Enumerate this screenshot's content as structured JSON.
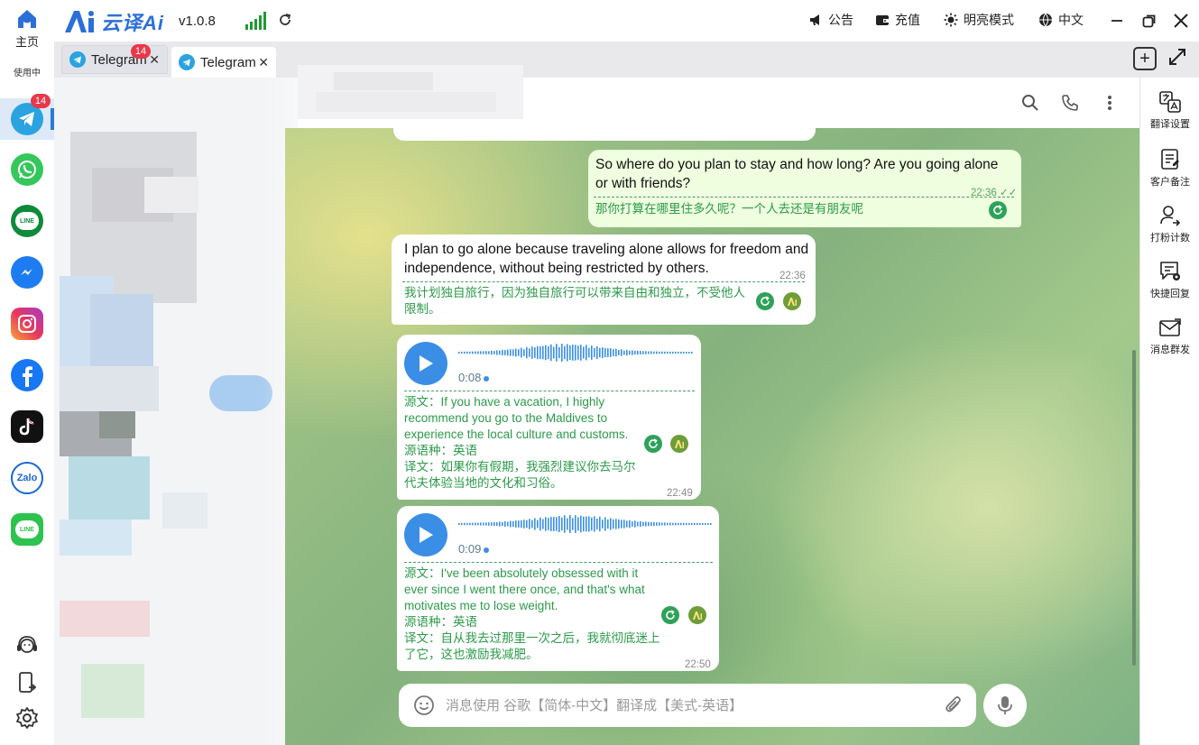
{
  "app": {
    "name": "云译Ai",
    "version": "v1.0.8",
    "home_label": "主页",
    "in_use_label": "使用中"
  },
  "titlebar": {
    "announcement": "公告",
    "recharge": "充值",
    "theme": "明亮模式",
    "language": "中文"
  },
  "sidebar": {
    "apps": [
      {
        "name": "Telegram",
        "icon": "telegram-icon",
        "badge": "14",
        "selected": true
      },
      {
        "name": "WhatsApp",
        "icon": "whatsapp-icon"
      },
      {
        "name": "LINE",
        "icon": "line-icon"
      },
      {
        "name": "Messenger",
        "icon": "messenger-icon"
      },
      {
        "name": "Instagram",
        "icon": "instagram-icon"
      },
      {
        "name": "Facebook",
        "icon": "facebook-icon"
      },
      {
        "name": "TikTok",
        "icon": "tiktok-icon"
      },
      {
        "name": "Zalo",
        "icon": "zalo-icon",
        "text": "Zalo"
      },
      {
        "name": "LINE",
        "icon": "line-icon"
      }
    ],
    "line_text": "LINE"
  },
  "tabs": [
    {
      "label": "Telegram",
      "badge": "14",
      "active": false
    },
    {
      "label": "Telegram",
      "active": true
    }
  ],
  "messages": [
    {
      "direction": "out",
      "text": "So where do you plan to stay and how long? Are you going alone or with friends?",
      "time": "22:36",
      "translation": "那你打算在哪里住多久呢？一个人去还是有朋友呢"
    },
    {
      "direction": "in",
      "text": "I plan to go alone because traveling alone allows for freedom and independence, without being restricted by others.",
      "time": "22:36",
      "translation": "我计划独自旅行，因为独自旅行可以带来自由和独立，不受他人限制。"
    },
    {
      "direction": "in",
      "type": "voice",
      "duration": "0:08",
      "source_label": "源文：",
      "source": "If you have a vacation, I highly recommend you go to the Maldives to experience the local culture and customs.",
      "source_lang_label": "源语种：",
      "source_lang": "英语",
      "translation_label": "译文：",
      "translation": "如果你有假期，我强烈建议你去马尔代夫体验当地的文化和习俗。",
      "time": "22:49"
    },
    {
      "direction": "in",
      "type": "voice",
      "duration": "0:09",
      "source_label": "源文：",
      "source": "I've been absolutely obsessed with it ever since I went there once, and that's what motivates me to lose weight.",
      "source_lang_label": "源语种：",
      "source_lang": "英语",
      "translation_label": "译文：",
      "translation": "自从我去过那里一次之后，我就彻底迷上了它，这也激励我减肥。",
      "time": "22:50"
    }
  ],
  "composer": {
    "placeholder": "消息使用 谷歌【简体-中文】翻译成【美式-英语】"
  },
  "tools": [
    {
      "label": "翻译设置",
      "icon": "translate-settings-icon"
    },
    {
      "label": "客户备注",
      "icon": "customer-notes-icon"
    },
    {
      "label": "打粉计数",
      "icon": "follower-count-icon"
    },
    {
      "label": "快捷回复",
      "icon": "quick-reply-icon"
    },
    {
      "label": "消息群发",
      "icon": "bulk-message-icon"
    }
  ],
  "colors": {
    "accent": "#2d6fd8",
    "telegram": "#2aa3e0",
    "translation_green": "#2c9a4a",
    "badge_red": "#e8384a"
  }
}
